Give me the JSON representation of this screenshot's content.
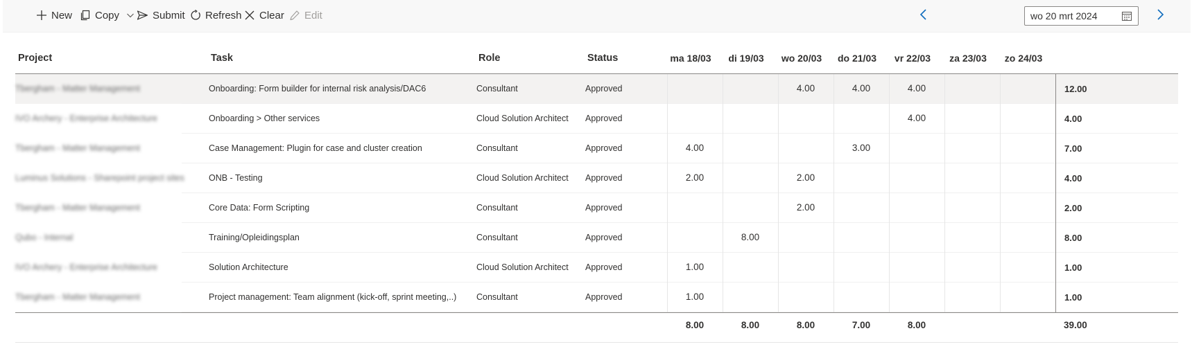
{
  "toolbar": {
    "new_label": "New",
    "copy_label": "Copy",
    "submit_label": "Submit",
    "refresh_label": "Refresh",
    "clear_label": "Clear",
    "edit_label": "Edit"
  },
  "date_picker": {
    "value": "wo 20 mrt 2024"
  },
  "columns": {
    "project": "Project",
    "task": "Task",
    "role": "Role",
    "status": "Status",
    "days": [
      "ma 18/03",
      "di 19/03",
      "wo 20/03",
      "do 21/03",
      "vr 22/03",
      "za 23/03",
      "zo 24/03"
    ]
  },
  "rows": [
    {
      "project": "Tbergham - Matter Management",
      "task": "Onboarding: Form builder for internal risk analysis/DAC6",
      "role": "Consultant",
      "status": "Approved",
      "days": [
        "",
        "",
        "4.00",
        "4.00",
        "4.00",
        "",
        ""
      ],
      "total": "12.00"
    },
    {
      "project": "IVO Archery - Enterprise Architecture",
      "task": "Onboarding > Other services",
      "role": "Cloud Solution Architect",
      "status": "Approved",
      "days": [
        "",
        "",
        "",
        "",
        "4.00",
        "",
        ""
      ],
      "total": "4.00"
    },
    {
      "project": "Tbergham - Matter Management",
      "task": "Case Management: Plugin for case and cluster creation",
      "role": "Consultant",
      "status": "Approved",
      "days": [
        "4.00",
        "",
        "",
        "3.00",
        "",
        "",
        ""
      ],
      "total": "7.00"
    },
    {
      "project": "Luminus Solutions - Sharepoint project sites",
      "task": "ONB - Testing",
      "role": "Cloud Solution Architect",
      "status": "Approved",
      "days": [
        "2.00",
        "",
        "2.00",
        "",
        "",
        "",
        ""
      ],
      "total": "4.00"
    },
    {
      "project": "Tbergham - Matter Management",
      "task": "Core Data: Form Scripting",
      "role": "Consultant",
      "status": "Approved",
      "days": [
        "",
        "",
        "2.00",
        "",
        "",
        "",
        ""
      ],
      "total": "2.00"
    },
    {
      "project": "Qubo - Internal",
      "task": "Training/Opleidingsplan",
      "role": "Consultant",
      "status": "Approved",
      "days": [
        "",
        "8.00",
        "",
        "",
        "",
        "",
        ""
      ],
      "total": "8.00"
    },
    {
      "project": "IVO Archery - Enterprise Architecture",
      "task": "Solution Architecture",
      "role": "Cloud Solution Architect",
      "status": "Approved",
      "days": [
        "1.00",
        "",
        "",
        "",
        "",
        "",
        ""
      ],
      "total": "1.00"
    },
    {
      "project": "Tbergham - Matter Management",
      "task": "Project management: Team alignment (kick-off, sprint meeting,..)",
      "role": "Consultant",
      "status": "Approved",
      "days": [
        "1.00",
        "",
        "",
        "",
        "",
        "",
        ""
      ],
      "total": "1.00"
    }
  ],
  "footer": {
    "days": [
      "8.00",
      "8.00",
      "8.00",
      "7.00",
      "8.00",
      "",
      ""
    ],
    "grand_total": "39.00"
  }
}
